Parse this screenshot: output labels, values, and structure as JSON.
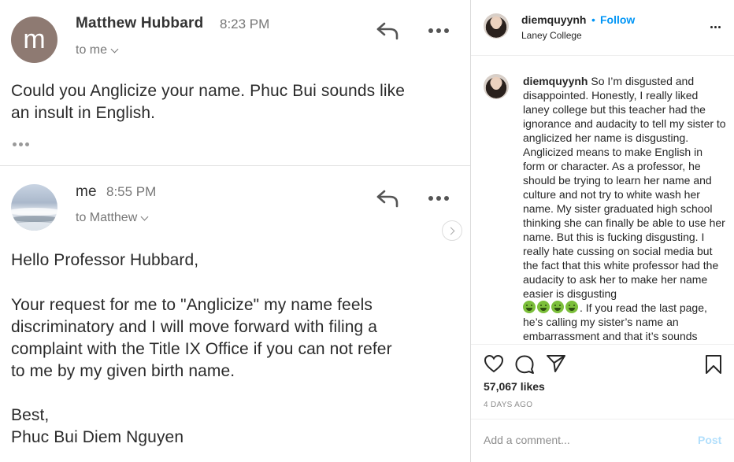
{
  "email": {
    "message1": {
      "avatar_letter": "m",
      "sender": "Matthew Hubbard",
      "time": "8:23 PM",
      "to": "to me",
      "body": [
        "Could you Anglicize your name. Phuc Bui sounds like",
        "an insult in English."
      ]
    },
    "message2": {
      "sender": "me",
      "time": "8:55 PM",
      "to": "to Matthew",
      "greeting": "Hello Professor Hubbard,",
      "body": [
        "Your request for me to \"Anglicize\" my name feels",
        "discriminatory and I will move forward with filing a",
        "complaint with the Title IX Office if you can not refer",
        "to me by my given birth name."
      ],
      "signoff": "Best,",
      "signature": "Phuc Bui Diem Nguyen"
    }
  },
  "instagram": {
    "header": {
      "username": "diemquyynh",
      "separator": "•",
      "follow_label": "Follow",
      "location": "Laney College"
    },
    "caption": {
      "username": "diemquyynh",
      "text_before_emoji": "So I’m disgusted and disappointed. Honestly, I really liked laney college but this teacher had the ignorance and audacity to tell my sister to anglicized her name is disgusting. Anglicized means to make English in form or character. As a professor, he should be trying to learn her name and culture and not try to white wash her name. My sister graduated high school thinking she can finally be able to use her name. But this is fucking disgusting. I really hate cussing on social media but the fact that this white professor had the audacity to ask her to make her name easier is disgusting",
      "emoji_count": 4,
      "emoji_name": "nauseated-face-emoji",
      "text_after_emoji": ". If you read the last page, he’s calling my sister’s name an embarrassment and that it’s sounds"
    },
    "likes": "57,067 likes",
    "date": "4 DAYS AGO",
    "comment_placeholder": "Add a comment...",
    "post_label": "Post",
    "colors": {
      "follow": "#0095f6",
      "post_disabled": "#b2dffc",
      "avatar_m": "#8e7a72"
    }
  }
}
